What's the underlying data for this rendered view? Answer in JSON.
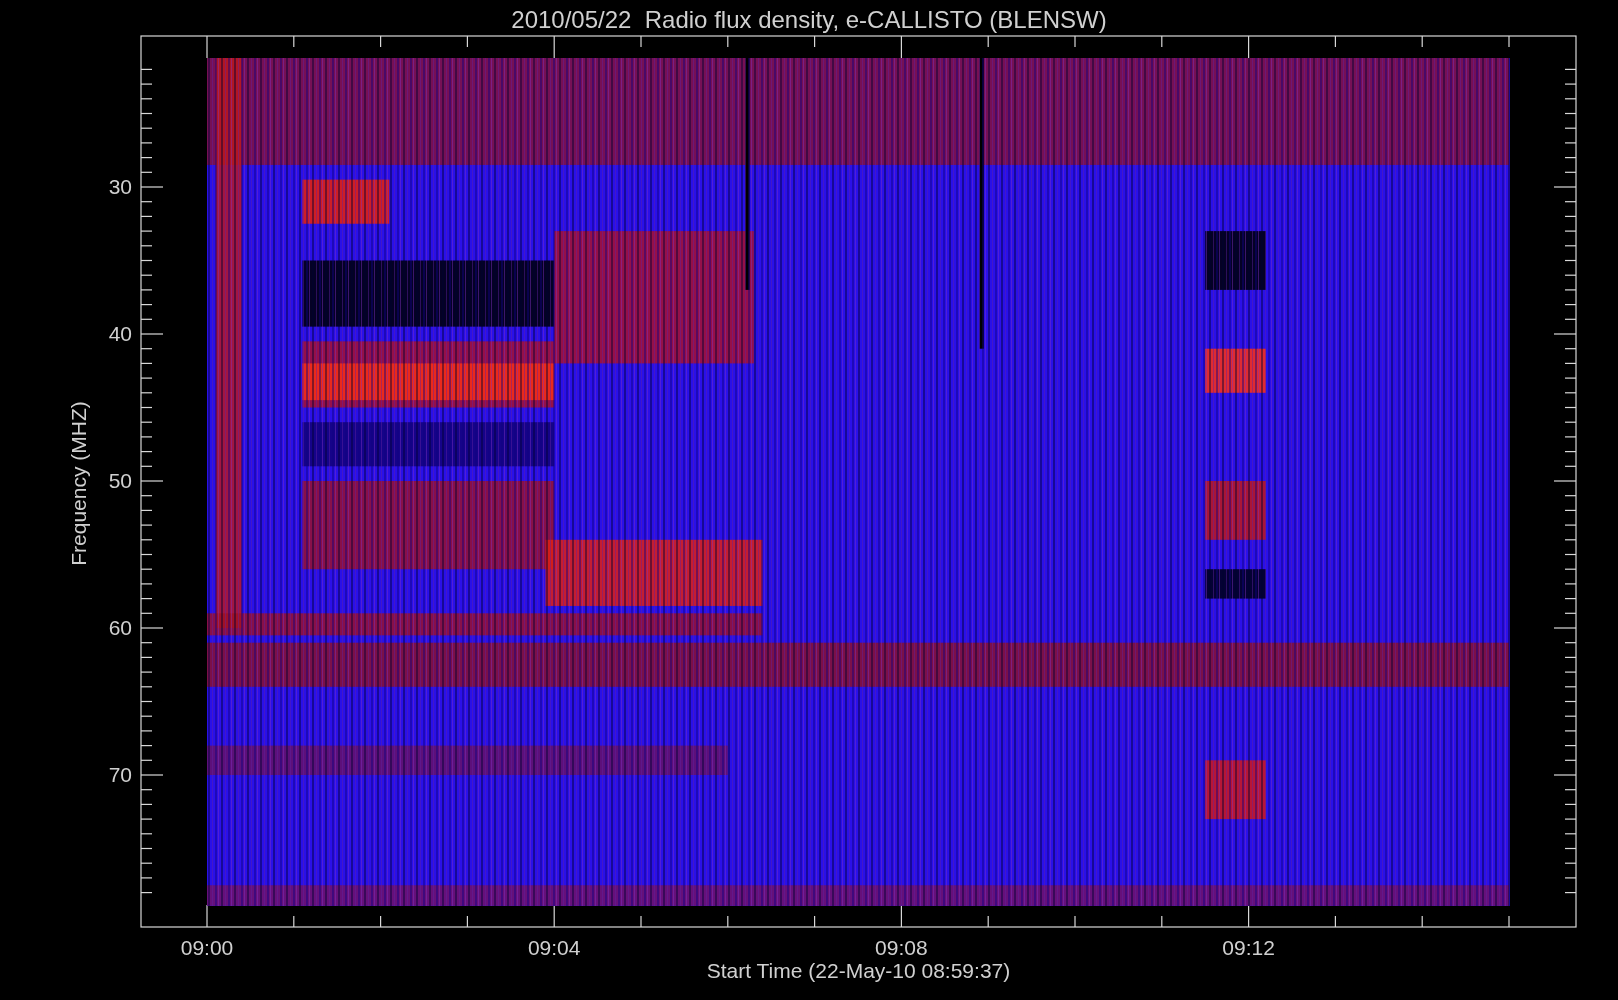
{
  "title": "2010/05/22  Radio flux density, e-CALLISTO (BLENSW)",
  "y_axis": {
    "label": "Frequency (MHZ)",
    "ticks": [
      "30",
      "40",
      "50",
      "60",
      "70"
    ]
  },
  "x_axis": {
    "label": "Start Time (22-May-10 08:59:37)",
    "ticks": [
      "09:00",
      "09:04",
      "09:08",
      "09:12"
    ]
  }
}
